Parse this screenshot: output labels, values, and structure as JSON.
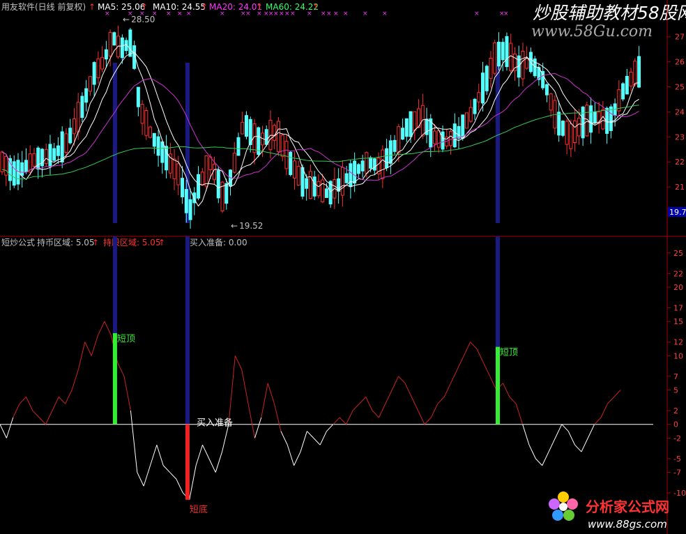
{
  "header": {
    "software": "用友软件(日线 前复权)",
    "arrow": "↑",
    "ma5": "MA5: 25.06",
    "ma10": "MA10: 24.55",
    "ma20": "MA20: 24.01",
    "ma60": "MA60: 24.22",
    "colors": {
      "ma5": "#ffffff",
      "ma10": "#ffffff",
      "ma20": "#ff33ff",
      "ma60": "#33ff66",
      "arrow": "#ff3030"
    }
  },
  "sub_header": {
    "formula": "短炒公式",
    "hold_coin": "持币区域: 5.05",
    "hold_stock": "持股区域: 5.05",
    "buy_ready": "买入准备: 0.00",
    "arrow": "↑",
    "colors": {
      "formula": "#c0c0c0",
      "hold_coin": "#c0c0c0",
      "hold_stock": "#ff3030",
      "buy_ready": "#c0c0c0"
    }
  },
  "annotations": {
    "high": "28.50",
    "low": "19.52",
    "high_arrow": "←",
    "low_arrow": "←",
    "price_tag": "19.7",
    "short_top_label": "短顶",
    "short_bottom_label": "短底",
    "buy_ready_label": "买入准备",
    "cross_marks": [
      "×",
      "××",
      "×",
      "×",
      "×",
      "×",
      "×",
      "×××",
      "×",
      "××××××",
      "×",
      "×",
      "×",
      "×",
      "×",
      "××",
      "××",
      "××"
    ]
  },
  "watermark_top": {
    "text": "炒股辅助教材58股网",
    "url": "www.58Gu.com"
  },
  "watermark_bottom": {
    "text": "分析家公式网",
    "url": "www.88gs.com"
  },
  "chart_data": [
    {
      "type": "candlestick",
      "title": "",
      "ylim": [
        19.5,
        27.8
      ],
      "yticks": [
        21,
        22,
        23,
        24,
        25,
        26,
        27
      ],
      "series": [
        {
          "name": "MA5",
          "color": "#ffffff"
        },
        {
          "name": "MA10",
          "color": "#ffffff"
        },
        {
          "name": "MA20",
          "color": "#cc33cc"
        },
        {
          "name": "MA60",
          "color": "#33cc55"
        }
      ],
      "high_marker": 28.5,
      "low_marker": 19.52,
      "vertical_markers": [
        0.176,
        0.287,
        0.762
      ],
      "keypoints": [
        [
          0,
          22.0
        ],
        [
          0.02,
          21.5
        ],
        [
          0.05,
          22.1
        ],
        [
          0.08,
          22.3
        ],
        [
          0.1,
          22.8
        ],
        [
          0.12,
          24.0
        ],
        [
          0.14,
          25.5
        ],
        [
          0.155,
          26.0
        ],
        [
          0.17,
          27.0
        ],
        [
          0.18,
          26.5
        ],
        [
          0.2,
          26.8
        ],
        [
          0.21,
          24.2
        ],
        [
          0.23,
          23.0
        ],
        [
          0.25,
          22.2
        ],
        [
          0.27,
          21.5
        ],
        [
          0.287,
          20.0
        ],
        [
          0.3,
          21.0
        ],
        [
          0.32,
          22.0
        ],
        [
          0.34,
          20.4
        ],
        [
          0.36,
          22.4
        ],
        [
          0.37,
          23.6
        ],
        [
          0.39,
          22.8
        ],
        [
          0.42,
          23.2
        ],
        [
          0.44,
          22.0
        ],
        [
          0.46,
          21.2
        ],
        [
          0.48,
          21.0
        ],
        [
          0.5,
          20.7
        ],
        [
          0.52,
          21.2
        ],
        [
          0.54,
          21.6
        ],
        [
          0.56,
          22.0
        ],
        [
          0.58,
          21.8
        ],
        [
          0.6,
          22.6
        ],
        [
          0.62,
          23.4
        ],
        [
          0.64,
          23.8
        ],
        [
          0.66,
          23.0
        ],
        [
          0.68,
          22.8
        ],
        [
          0.7,
          23.2
        ],
        [
          0.72,
          24.0
        ],
        [
          0.74,
          25.2
        ],
        [
          0.755,
          26.2
        ],
        [
          0.77,
          26.5
        ],
        [
          0.79,
          25.8
        ],
        [
          0.81,
          26.0
        ],
        [
          0.83,
          25.2
        ],
        [
          0.85,
          23.6
        ],
        [
          0.87,
          23.0
        ],
        [
          0.89,
          23.6
        ],
        [
          0.91,
          23.8
        ],
        [
          0.93,
          23.6
        ],
        [
          0.95,
          24.8
        ],
        [
          0.97,
          25.6
        ]
      ]
    },
    {
      "type": "line",
      "title": "",
      "ylim": [
        -10.5,
        26.5
      ],
      "yticks": [
        -10,
        -7,
        -5,
        -2,
        0,
        2,
        5,
        7,
        10,
        12,
        15,
        17,
        20,
        22,
        25
      ],
      "series": [
        {
          "name": "短炒公式",
          "x": [
            0,
            0.01,
            0.02,
            0.03,
            0.04,
            0.05,
            0.06,
            0.07,
            0.08,
            0.09,
            0.1,
            0.11,
            0.12,
            0.13,
            0.14,
            0.15,
            0.16,
            0.17,
            0.18,
            0.19,
            0.2,
            0.21,
            0.22,
            0.23,
            0.24,
            0.25,
            0.26,
            0.27,
            0.28,
            0.29,
            0.3,
            0.31,
            0.32,
            0.33,
            0.34,
            0.35,
            0.36,
            0.37,
            0.38,
            0.39,
            0.4,
            0.41,
            0.42,
            0.43,
            0.44,
            0.45,
            0.46,
            0.47,
            0.48,
            0.49,
            0.5,
            0.51,
            0.52,
            0.53,
            0.54,
            0.55,
            0.56,
            0.57,
            0.58,
            0.59,
            0.6,
            0.61,
            0.62,
            0.63,
            0.64,
            0.65,
            0.66,
            0.67,
            0.68,
            0.69,
            0.7,
            0.71,
            0.72,
            0.73,
            0.74,
            0.75,
            0.76,
            0.77,
            0.78,
            0.79,
            0.8,
            0.81,
            0.82,
            0.83,
            0.84,
            0.85,
            0.86,
            0.87,
            0.88,
            0.89,
            0.9,
            0.91,
            0.92,
            0.93,
            0.94,
            0.95
          ],
          "values": [
            0,
            -2,
            1,
            3,
            4,
            2,
            1,
            0,
            2,
            4,
            3,
            5,
            8,
            12,
            10,
            13,
            15,
            13,
            9,
            7,
            2,
            -7,
            -9,
            -6,
            -3,
            -6,
            -7,
            -8,
            -10,
            -11,
            -6,
            -3,
            -5,
            -7,
            -4,
            0,
            10,
            8,
            3,
            -2,
            1,
            6,
            3,
            -1,
            -3,
            -6,
            -4,
            -1,
            -2,
            -3,
            -1,
            0,
            1,
            0,
            2,
            3,
            4,
            2,
            1,
            3,
            5,
            7,
            6,
            4,
            2,
            0,
            1,
            3,
            4,
            6,
            8,
            10,
            12,
            11,
            9,
            7,
            5,
            6,
            4,
            3,
            0,
            -3,
            -5,
            -6,
            -4,
            -2,
            0,
            -1,
            -3,
            -4,
            -2,
            0,
            1,
            3,
            4,
            5
          ]
        }
      ],
      "signals": [
        {
          "label": "短顶",
          "x": 0.176,
          "value": 13.3,
          "color": "#33ee33"
        },
        {
          "label": "短底",
          "x": 0.287,
          "value": -11.0,
          "color": "#ee2222"
        },
        {
          "label": "短顶",
          "x": 0.762,
          "value": 11.3,
          "color": "#33ee33"
        }
      ]
    }
  ]
}
